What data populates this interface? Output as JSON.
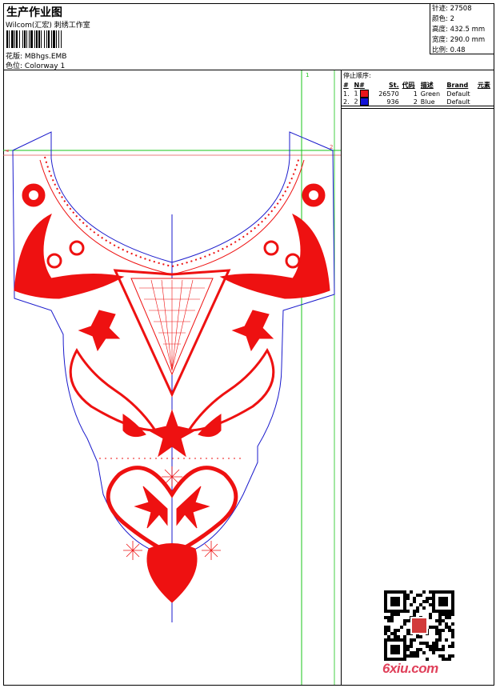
{
  "header": {
    "title": "生产作业图",
    "subtitle": "Wilcom(汇宏) 刺绣工作室",
    "design_label": "花版: ",
    "design_value": "MBhgs.EMB",
    "colorway_label": "色位: ",
    "colorway_value": "Colorway 1"
  },
  "stats": [
    {
      "label": "针迹: ",
      "value": "27508"
    },
    {
      "label": "颜色: ",
      "value": "2"
    },
    {
      "label": "高度: ",
      "value": "432.5 mm"
    },
    {
      "label": "宽度: ",
      "value": "290.0 mm"
    },
    {
      "label": "比例: ",
      "value": "0.48"
    }
  ],
  "stop_sequence": {
    "title": "停止顺序:",
    "columns": [
      "#",
      "N#",
      "St.",
      "代码",
      "描述",
      "Brand",
      "元素"
    ],
    "rows": [
      {
        "index": "1.",
        "n": "1",
        "color": "#e8141c",
        "stitches": "26570",
        "code": "1",
        "desc": "Green",
        "brand": "Default"
      },
      {
        "index": "2.",
        "n": "2",
        "color": "#1212d8",
        "stitches": "936",
        "code": "2",
        "desc": "Blue",
        "brand": "Default"
      }
    ]
  },
  "guides": {
    "label_1": "1",
    "label_2": "2"
  },
  "watermark": {
    "text": "6xiu.com"
  },
  "colors": {
    "embroidery_red": "#ee1111",
    "outline_blue": "#1a1acc",
    "guide_green": "#18c418"
  }
}
